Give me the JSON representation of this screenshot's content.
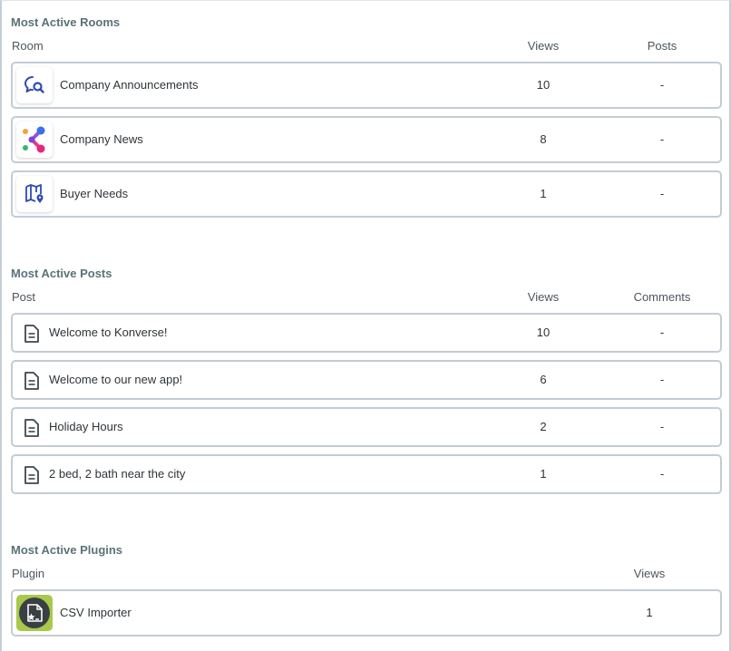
{
  "rooms": {
    "title": "Most Active Rooms",
    "headers": {
      "name": "Room",
      "col1": "Views",
      "col2": "Posts"
    },
    "items": [
      {
        "name": "Company Announcements",
        "views": "10",
        "posts": "-",
        "icon": "search-chat-icon"
      },
      {
        "name": "Company News",
        "views": "8",
        "posts": "-",
        "icon": "share-network-icon"
      },
      {
        "name": "Buyer Needs",
        "views": "1",
        "posts": "-",
        "icon": "map-pin-icon"
      }
    ]
  },
  "posts": {
    "title": "Most Active Posts",
    "headers": {
      "name": "Post",
      "col1": "Views",
      "col2": "Comments"
    },
    "items": [
      {
        "name": "Welcome to Konverse!",
        "views": "10",
        "comments": "-",
        "icon": "document-icon"
      },
      {
        "name": "Welcome to our new app!",
        "views": "6",
        "comments": "-",
        "icon": "document-icon"
      },
      {
        "name": "Holiday Hours",
        "views": "2",
        "comments": "-",
        "icon": "document-icon"
      },
      {
        "name": "2 bed, 2 bath near the city",
        "views": "1",
        "comments": "-",
        "icon": "document-icon"
      }
    ]
  },
  "plugins": {
    "title": "Most Active Plugins",
    "headers": {
      "name": "Plugin",
      "col1": "Views"
    },
    "items": [
      {
        "name": "CSV Importer",
        "views": "1",
        "icon": "csv-import-icon"
      }
    ]
  },
  "colors": {
    "section_title": "#5b7279",
    "row_border": "#c4ccd3",
    "plugin_icon_bg": "#a8c94a",
    "room_icon_blue": "#2d4bb3"
  }
}
